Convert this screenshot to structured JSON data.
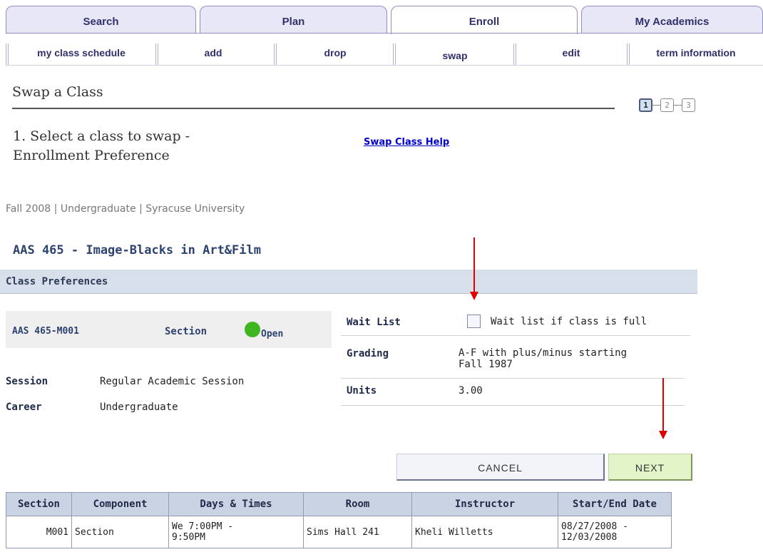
{
  "main_tabs": [
    {
      "label": "Search"
    },
    {
      "label": "Plan"
    },
    {
      "label": "Enroll"
    },
    {
      "label": "My Academics"
    }
  ],
  "sub_tabs": [
    {
      "label": "my class schedule"
    },
    {
      "label": "add"
    },
    {
      "label": "drop"
    },
    {
      "label": "swap"
    },
    {
      "label": "edit"
    },
    {
      "label": "term information"
    }
  ],
  "page": {
    "title": "Swap a Class",
    "steps": [
      "1",
      "2",
      "3"
    ],
    "subtitle_line1": "1. Select a class to swap -",
    "subtitle_line2": "Enrollment Preference",
    "help_link": "Swap Class Help",
    "term_line": "Fall 2008 | Undergraduate | Syracuse University",
    "course_header": "AAS 465 - Image-Blacks in Art&Film"
  },
  "preferences": {
    "bar_title": "Class Preferences",
    "section_code": "AAS 465-M001",
    "section_label": "Section",
    "status": "Open",
    "session_label": "Session",
    "session_value": "Regular Academic Session",
    "career_label": "Career",
    "career_value": "Undergraduate",
    "waitlist_label": "Wait List",
    "waitlist_checkbox_text": "Wait list if class is full",
    "grading_label": "Grading",
    "grading_line1": "A-F with plus/minus starting",
    "grading_line2": "Fall 1987",
    "units_label": "Units",
    "units_value": "3.00"
  },
  "buttons": {
    "cancel": "CANCEL",
    "next": "NEXT"
  },
  "class_table": {
    "headers": [
      "Section",
      "Component",
      "Days & Times",
      "Room",
      "Instructor",
      "Start/End Date"
    ],
    "rows": [
      {
        "section": "M001",
        "component": "Section",
        "days_times_1": "We 7:00PM -",
        "days_times_2": "9:50PM",
        "room": "Sims Hall 241",
        "instructor": "Kheli Willetts",
        "dates_1": "08/27/2008 -",
        "dates_2": "12/03/2008"
      }
    ]
  },
  "colors": {
    "tab_text": "#30306a",
    "heading": "#2e4272",
    "open_status": "#3fb51f",
    "annotation_arrow": "#dd0000",
    "link": "#0000cc"
  }
}
